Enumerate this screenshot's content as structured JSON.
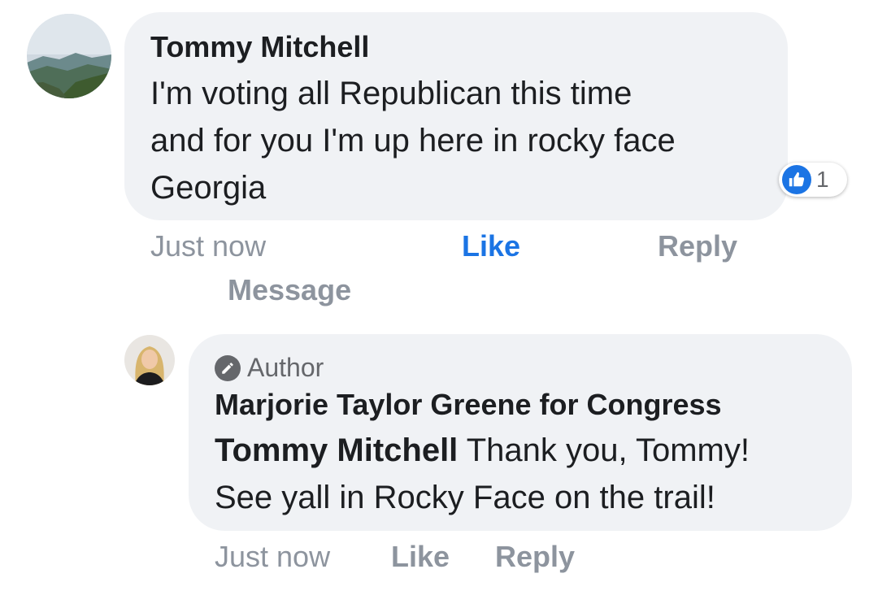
{
  "comment": {
    "author": "Tommy Mitchell",
    "lines": [
      "I'm voting all Republican this time",
      "and for you I'm up here in rocky face",
      "Georgia"
    ],
    "reaction_count": "1",
    "time": "Just now",
    "like_label": "Like",
    "reply_label": "Reply",
    "message_label": "Message",
    "liked": true,
    "accent_color": "#1b74e4"
  },
  "reply": {
    "badge": "Author",
    "author": "Marjorie Taylor Greene for Congress",
    "mention": "Tommy Mitchell",
    "lines": [
      "Thank you, Tommy!",
      "See yall in Rocky Face on the trail!"
    ],
    "time": "Just now",
    "like_label": "Like",
    "reply_label": "Reply"
  }
}
